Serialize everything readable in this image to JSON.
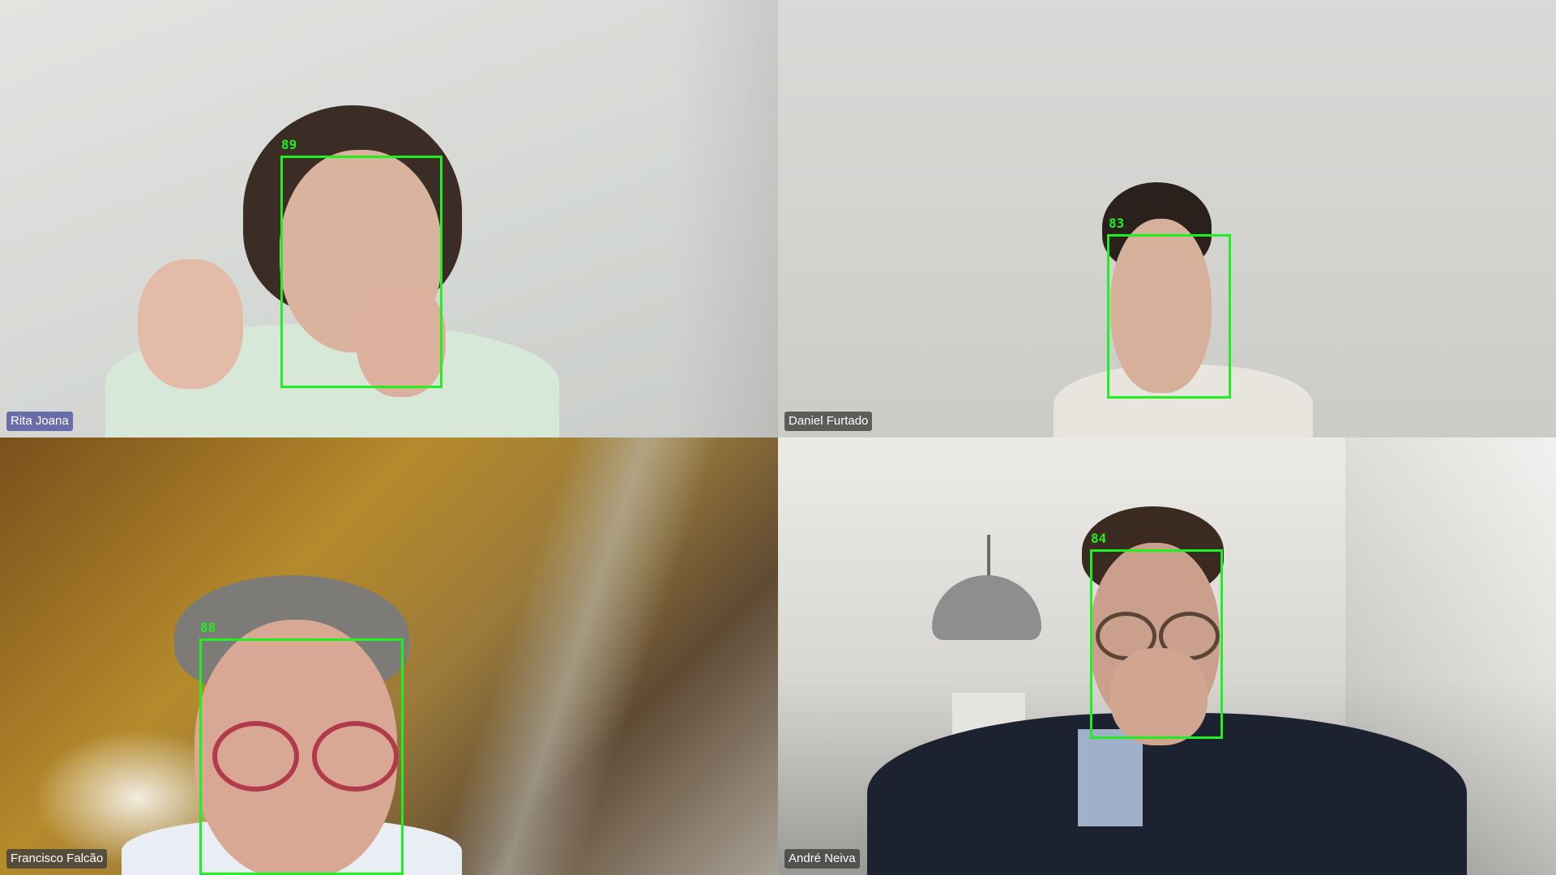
{
  "meeting": {
    "layout": "2x2 gallery",
    "participants": [
      {
        "name": "Rita Joana",
        "face_score": "89",
        "name_tag_color": "#6264a7",
        "background_tone": "#d8dad6"
      },
      {
        "name": "Daniel Furtado",
        "face_score": "83",
        "name_tag_color": "#3c3c3c",
        "background_tone": "#d4d4d1"
      },
      {
        "name": "Francisco Falcão",
        "face_score": "88",
        "name_tag_color": "#3c3c3c",
        "background_tone": "#9c7b3a"
      },
      {
        "name": "André Neiva",
        "face_score": "84",
        "name_tag_color": "#3c3c3c",
        "background_tone": "#e2e0dc"
      }
    ]
  },
  "colors": {
    "face_box": "#1ff01f",
    "name_tag_text": "#ffffff"
  },
  "icons": {
    "face_detection_box": "green-rectangle-outline"
  }
}
